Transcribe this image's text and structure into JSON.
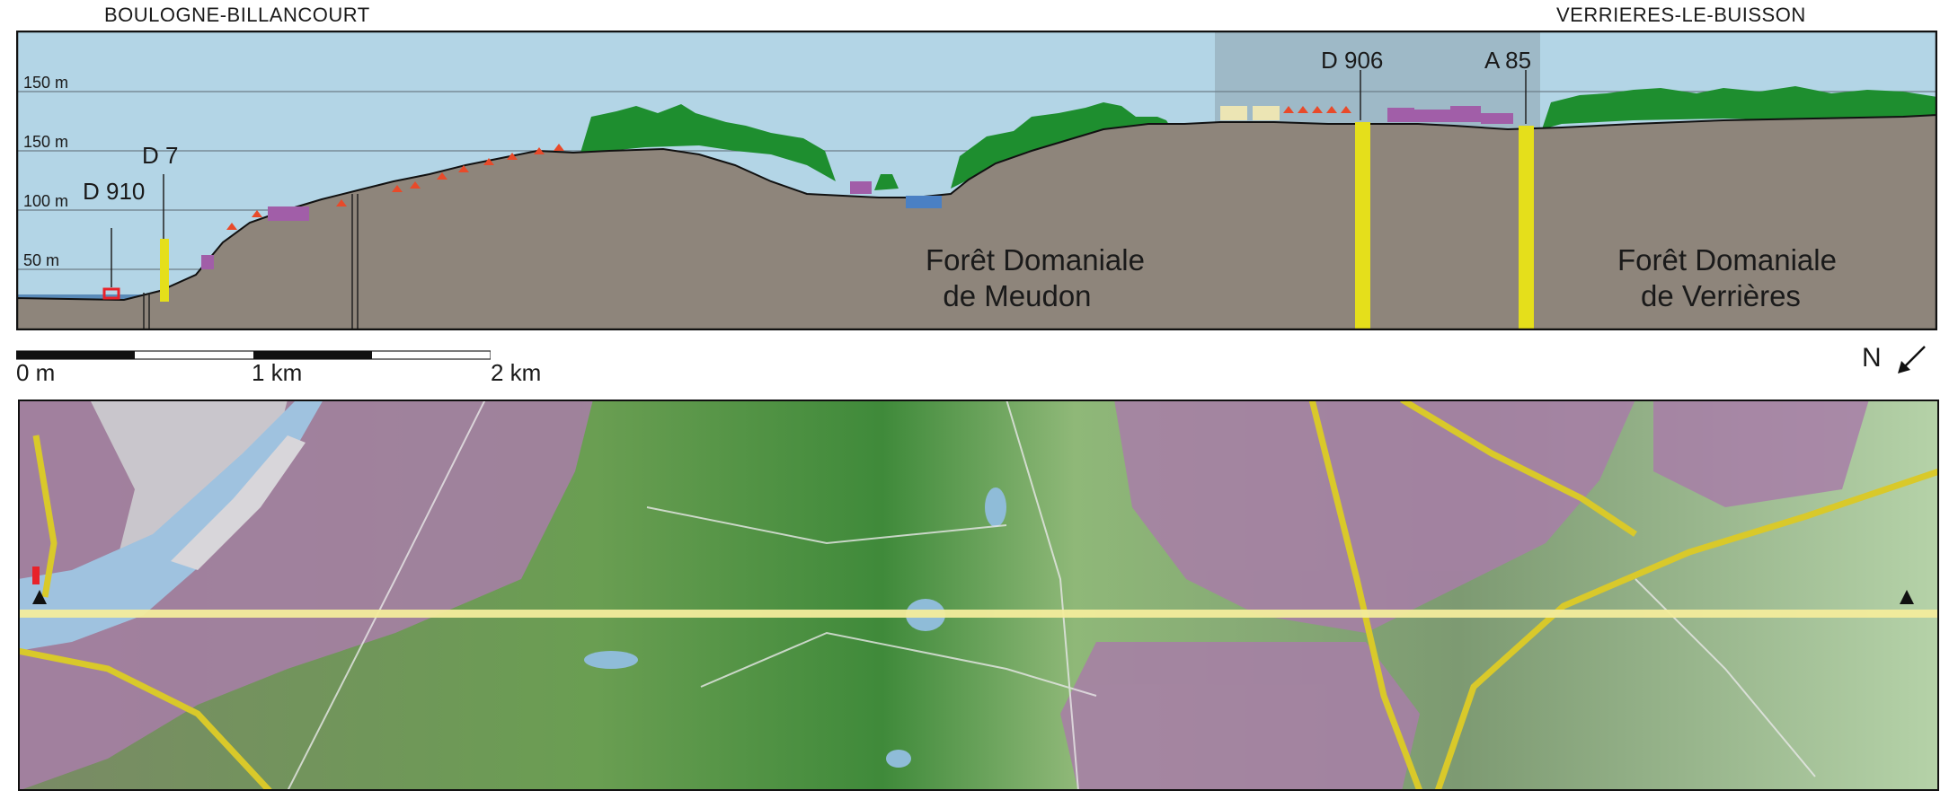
{
  "header": {
    "left_city": "BOULOGNE-BILLANCOURT",
    "right_city": "VERRIERES-LE-BUISSON"
  },
  "profile": {
    "elevation_labels": [
      "150 m",
      "150 m",
      "100 m",
      "50 m"
    ],
    "roads": [
      "D 910",
      "D 7",
      "D 906",
      "A 85"
    ],
    "forests": [
      {
        "line1": "Forêt Domaniale",
        "line2": "de Meudon"
      },
      {
        "line1": "Forêt Domaniale",
        "line2": "de Verrières"
      }
    ]
  },
  "scale_bar": {
    "labels": [
      "0 m",
      "1 km",
      "2 km"
    ]
  },
  "north_arrow": {
    "label": "N"
  },
  "colors": {
    "sky": "#b3d5e6",
    "ground": "#8e857b",
    "forest": "#1e8e2f",
    "road": "#e5df1b",
    "water": "#4a80c4",
    "buildings": "#a15ea8",
    "map_green": "#5f9e4a",
    "section_line": "#f3ec9c"
  }
}
